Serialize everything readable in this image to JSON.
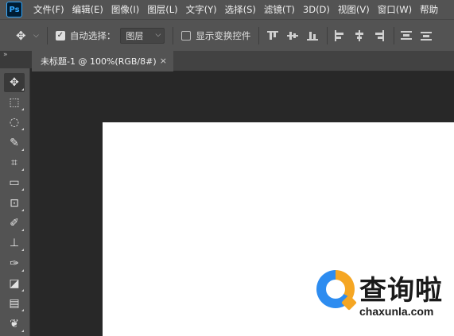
{
  "app": {
    "logo_text": "Ps"
  },
  "menu": [
    "文件(F)",
    "编辑(E)",
    "图像(I)",
    "图层(L)",
    "文字(Y)",
    "选择(S)",
    "滤镜(T)",
    "3D(D)",
    "视图(V)",
    "窗口(W)",
    "帮助"
  ],
  "options": {
    "auto_select_label": "自动选择：",
    "auto_select_checked": true,
    "auto_select_value": "图层",
    "show_transform_label": "显示变换控件",
    "show_transform_checked": false
  },
  "document_tab": {
    "title": "未标题-1 @ 100%(RGB/8#)",
    "close_glyph": "×"
  },
  "collapse_glyph": "»",
  "tools": [
    {
      "name": "move-tool-icon",
      "glyph": "✥",
      "active": true
    },
    {
      "name": "marquee-tool-icon",
      "glyph": "⬚"
    },
    {
      "name": "lasso-tool-icon",
      "glyph": "◌"
    },
    {
      "name": "quick-selection-tool-icon",
      "glyph": "✎"
    },
    {
      "name": "crop-tool-icon",
      "glyph": "⌗"
    },
    {
      "name": "ruler-tool-icon",
      "glyph": "▭"
    },
    {
      "name": "patch-tool-icon",
      "glyph": "⊡"
    },
    {
      "name": "brush-tool-icon",
      "glyph": "✐"
    },
    {
      "name": "stamp-tool-icon",
      "glyph": "⊥"
    },
    {
      "name": "history-brush-tool-icon",
      "glyph": "✑"
    },
    {
      "name": "eraser-tool-icon",
      "glyph": "◪"
    },
    {
      "name": "gradient-tool-icon",
      "glyph": "▤"
    },
    {
      "name": "smudge-tool-icon",
      "glyph": "❦"
    }
  ],
  "watermark": {
    "title": "查询啦",
    "url": "chaxunla.com",
    "colors": {
      "orange": "#f5a623",
      "blue": "#2d8cf0"
    }
  }
}
